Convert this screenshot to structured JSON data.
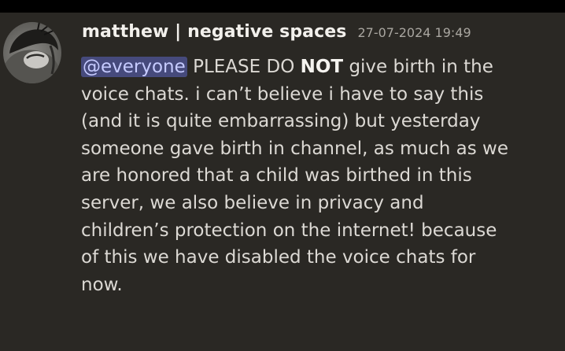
{
  "message": {
    "author": "matthew | negative spaces",
    "timestamp": "27-07-2024 19:49",
    "mention": "@everyone",
    "emphasis_pre": "PLEASE DO",
    "emphasis_word": "NOT",
    "emphasis_post": "give birth in the",
    "lines": [
      "voice chats. i can’t believe i have to say this",
      "(and it is quite embarrassing) but yesterday",
      "someone gave birth in channel, as much as we",
      "are honored that a child was birthed in this",
      "server, we also believe in privacy and",
      "children’s protection on the internet! because",
      "of this we have disabled the voice chats for",
      "now."
    ]
  },
  "colors": {
    "background": "#2a2824",
    "mention_bg": "#464a7c",
    "mention_text": "#c6cbff"
  },
  "icons": {
    "avatar": "user-avatar"
  }
}
